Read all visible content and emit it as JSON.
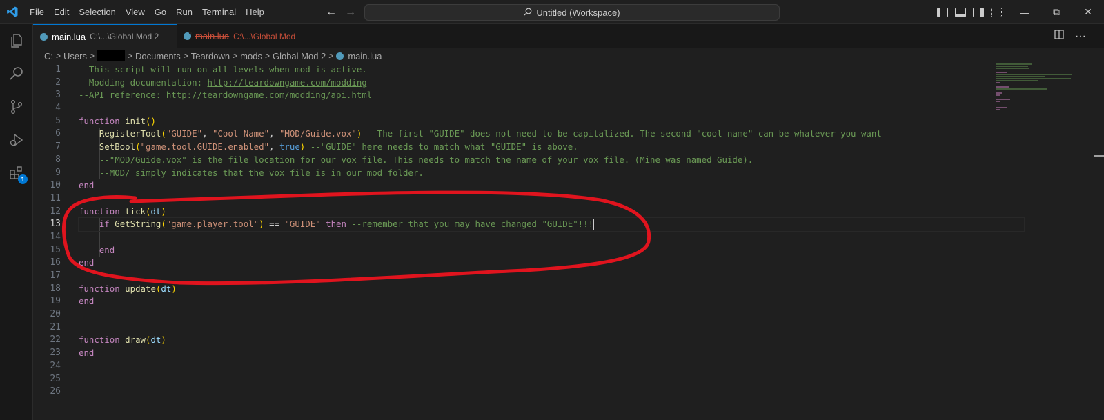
{
  "menu": [
    "File",
    "Edit",
    "Selection",
    "View",
    "Go",
    "Run",
    "Terminal",
    "Help"
  ],
  "command_center": {
    "label": "Untitled (Workspace)",
    "icon": "search-icon"
  },
  "tabs": [
    {
      "name": "main.lua",
      "path": "C:\\...\\Global Mod 2",
      "state": "active"
    },
    {
      "name": "main.lua",
      "path": "C:\\...\\Global Mod",
      "state": "deleted"
    }
  ],
  "breadcrumb": [
    "C:",
    "Users",
    "",
    "Documents",
    "Teardown",
    "mods",
    "Global Mod 2",
    "main.lua"
  ],
  "activity_badge": "1",
  "line_numbers": [
    "1",
    "2",
    "3",
    "4",
    "5",
    "6",
    "7",
    "8",
    "9",
    "10",
    "11",
    "12",
    "13",
    "14",
    "15",
    "16",
    "17",
    "18",
    "19",
    "20",
    "21",
    "22",
    "23",
    "24",
    "25",
    "26"
  ],
  "code": {
    "l1": "--This script will run on all levels when mod is active.",
    "l2_prefix": "--Modding documentation: ",
    "l2_url": "http://teardowngame.com/modding",
    "l3_prefix": "--API reference: ",
    "l3_url": "http://teardowngame.com/modding/api.html",
    "kw_function": "function",
    "kw_end": "end",
    "kw_if": "if",
    "kw_then": "then",
    "kw_true": "true",
    "fn_init": "init",
    "fn_tick": "tick",
    "fn_update": "update",
    "fn_draw": "draw",
    "param_dt": "dt",
    "fn_registertool": "RegisterTool",
    "str_guide": "\"GUIDE\"",
    "str_coolname": "\"Cool Name\"",
    "str_voxpath": "\"MOD/Guide.vox\"",
    "c6": "--The first \"GUIDE\" does not need to be capitalized. The second \"cool name\" can be whatever you want",
    "fn_setbool": "SetBool",
    "str_enabled": "\"game.tool.GUIDE.enabled\"",
    "c7": "--\"GUIDE\" here needs to match what \"GUIDE\" is above.",
    "c8": "--\"MOD/Guide.vox\" is the file location for our vox file. This needs to match the name of your vox file. (Mine was named Guide).",
    "c9": "--MOD/ simply indicates that the vox file is in our mod folder.",
    "fn_getstring": "GetString",
    "str_playertool": "\"game.player.tool\"",
    "op_eq": "==",
    "c13": "--remember that you may have changed \"GUIDE\"!!!"
  },
  "colors": {
    "accent": "#0078d4",
    "annotation": "#e0141e",
    "comment": "#6a9955",
    "keyword": "#c586c0",
    "function": "#dcdcaa",
    "string": "#ce9178"
  }
}
